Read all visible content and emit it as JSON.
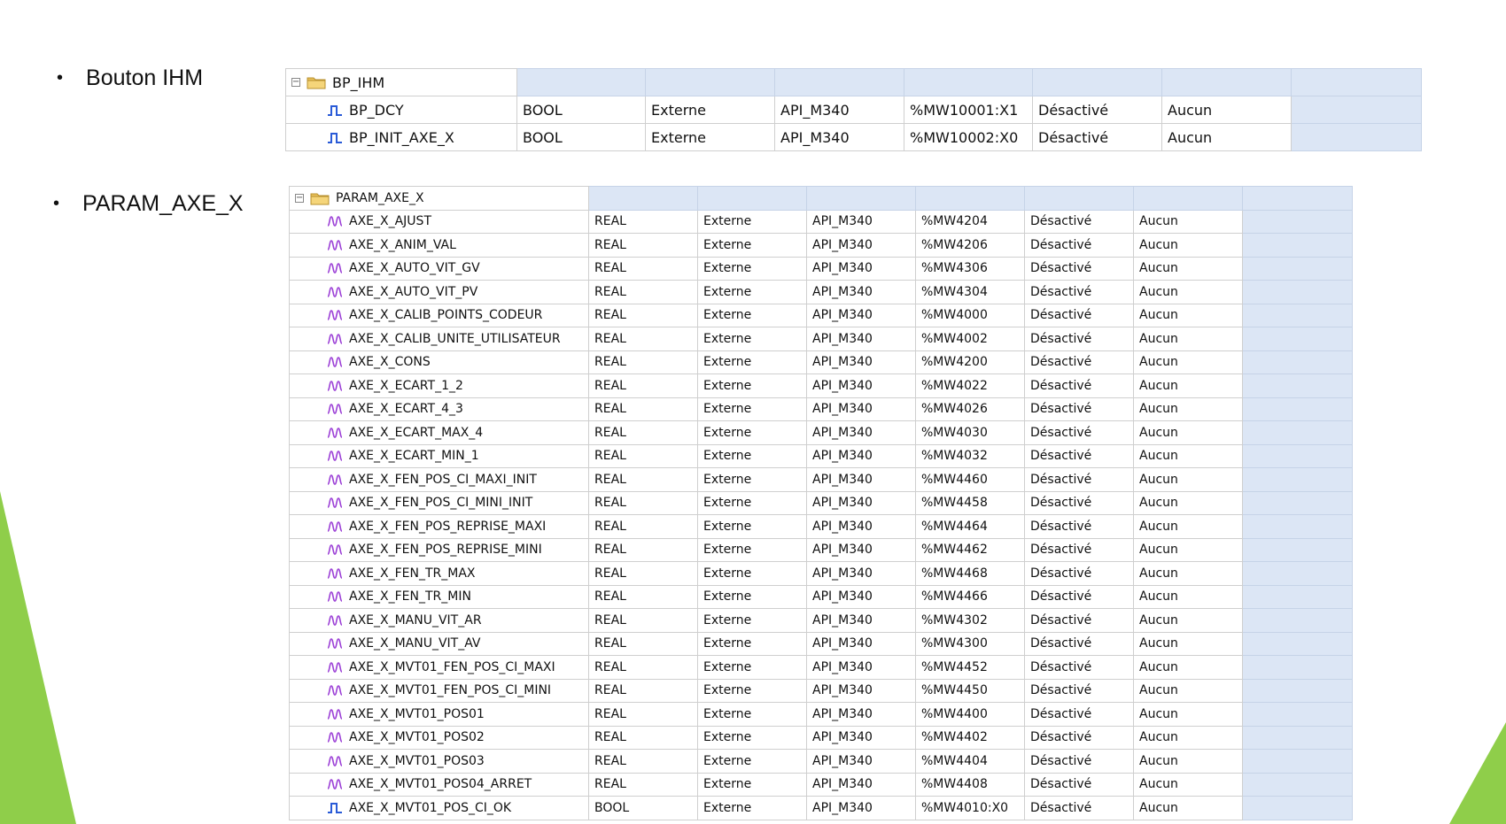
{
  "colors": {
    "accent_green": "#8fce4a",
    "header_fill": "#dce6f5",
    "bool_icon": "#2a5bd7",
    "real_icon": "#9b3fd6"
  },
  "bullets": [
    {
      "label": "Bouton IHM"
    },
    {
      "label": "PARAM_AXE_X"
    }
  ],
  "bp_ihm": {
    "group_name": "BP_IHM",
    "rows": [
      {
        "icon": "bool-icon",
        "name": "BP_DCY",
        "type": "BOOL",
        "scope": "Externe",
        "device": "API_M340",
        "address": "%MW10001:X1",
        "status": "Désactivé",
        "action": "Aucun"
      },
      {
        "icon": "bool-icon",
        "name": "BP_INIT_AXE_X",
        "type": "BOOL",
        "scope": "Externe",
        "device": "API_M340",
        "address": "%MW10002:X0",
        "status": "Désactivé",
        "action": "Aucun"
      }
    ]
  },
  "param_axe_x": {
    "group_name": "PARAM_AXE_X",
    "rows": [
      {
        "icon": "real-icon",
        "name": "AXE_X_AJUST",
        "type": "REAL",
        "scope": "Externe",
        "device": "API_M340",
        "address": "%MW4204",
        "status": "Désactivé",
        "action": "Aucun"
      },
      {
        "icon": "real-icon",
        "name": "AXE_X_ANIM_VAL",
        "type": "REAL",
        "scope": "Externe",
        "device": "API_M340",
        "address": "%MW4206",
        "status": "Désactivé",
        "action": "Aucun"
      },
      {
        "icon": "real-icon",
        "name": "AXE_X_AUTO_VIT_GV",
        "type": "REAL",
        "scope": "Externe",
        "device": "API_M340",
        "address": "%MW4306",
        "status": "Désactivé",
        "action": "Aucun"
      },
      {
        "icon": "real-icon",
        "name": "AXE_X_AUTO_VIT_PV",
        "type": "REAL",
        "scope": "Externe",
        "device": "API_M340",
        "address": "%MW4304",
        "status": "Désactivé",
        "action": "Aucun"
      },
      {
        "icon": "real-icon",
        "name": "AXE_X_CALIB_POINTS_CODEUR",
        "type": "REAL",
        "scope": "Externe",
        "device": "API_M340",
        "address": "%MW4000",
        "status": "Désactivé",
        "action": "Aucun"
      },
      {
        "icon": "real-icon",
        "name": "AXE_X_CALIB_UNITE_UTILISATEUR",
        "type": "REAL",
        "scope": "Externe",
        "device": "API_M340",
        "address": "%MW4002",
        "status": "Désactivé",
        "action": "Aucun"
      },
      {
        "icon": "real-icon",
        "name": "AXE_X_CONS",
        "type": "REAL",
        "scope": "Externe",
        "device": "API_M340",
        "address": "%MW4200",
        "status": "Désactivé",
        "action": "Aucun"
      },
      {
        "icon": "real-icon",
        "name": "AXE_X_ECART_1_2",
        "type": "REAL",
        "scope": "Externe",
        "device": "API_M340",
        "address": "%MW4022",
        "status": "Désactivé",
        "action": "Aucun"
      },
      {
        "icon": "real-icon",
        "name": "AXE_X_ECART_4_3",
        "type": "REAL",
        "scope": "Externe",
        "device": "API_M340",
        "address": "%MW4026",
        "status": "Désactivé",
        "action": "Aucun"
      },
      {
        "icon": "real-icon",
        "name": "AXE_X_ECART_MAX_4",
        "type": "REAL",
        "scope": "Externe",
        "device": "API_M340",
        "address": "%MW4030",
        "status": "Désactivé",
        "action": "Aucun"
      },
      {
        "icon": "real-icon",
        "name": "AXE_X_ECART_MIN_1",
        "type": "REAL",
        "scope": "Externe",
        "device": "API_M340",
        "address": "%MW4032",
        "status": "Désactivé",
        "action": "Aucun"
      },
      {
        "icon": "real-icon",
        "name": "AXE_X_FEN_POS_CI_MAXI_INIT",
        "type": "REAL",
        "scope": "Externe",
        "device": "API_M340",
        "address": "%MW4460",
        "status": "Désactivé",
        "action": "Aucun"
      },
      {
        "icon": "real-icon",
        "name": "AXE_X_FEN_POS_CI_MINI_INIT",
        "type": "REAL",
        "scope": "Externe",
        "device": "API_M340",
        "address": "%MW4458",
        "status": "Désactivé",
        "action": "Aucun"
      },
      {
        "icon": "real-icon",
        "name": "AXE_X_FEN_POS_REPRISE_MAXI",
        "type": "REAL",
        "scope": "Externe",
        "device": "API_M340",
        "address": "%MW4464",
        "status": "Désactivé",
        "action": "Aucun"
      },
      {
        "icon": "real-icon",
        "name": "AXE_X_FEN_POS_REPRISE_MINI",
        "type": "REAL",
        "scope": "Externe",
        "device": "API_M340",
        "address": "%MW4462",
        "status": "Désactivé",
        "action": "Aucun"
      },
      {
        "icon": "real-icon",
        "name": "AXE_X_FEN_TR_MAX",
        "type": "REAL",
        "scope": "Externe",
        "device": "API_M340",
        "address": "%MW4468",
        "status": "Désactivé",
        "action": "Aucun"
      },
      {
        "icon": "real-icon",
        "name": "AXE_X_FEN_TR_MIN",
        "type": "REAL",
        "scope": "Externe",
        "device": "API_M340",
        "address": "%MW4466",
        "status": "Désactivé",
        "action": "Aucun"
      },
      {
        "icon": "real-icon",
        "name": "AXE_X_MANU_VIT_AR",
        "type": "REAL",
        "scope": "Externe",
        "device": "API_M340",
        "address": "%MW4302",
        "status": "Désactivé",
        "action": "Aucun"
      },
      {
        "icon": "real-icon",
        "name": "AXE_X_MANU_VIT_AV",
        "type": "REAL",
        "scope": "Externe",
        "device": "API_M340",
        "address": "%MW4300",
        "status": "Désactivé",
        "action": "Aucun"
      },
      {
        "icon": "real-icon",
        "name": "AXE_X_MVT01_FEN_POS_CI_MAXI",
        "type": "REAL",
        "scope": "Externe",
        "device": "API_M340",
        "address": "%MW4452",
        "status": "Désactivé",
        "action": "Aucun"
      },
      {
        "icon": "real-icon",
        "name": "AXE_X_MVT01_FEN_POS_CI_MINI",
        "type": "REAL",
        "scope": "Externe",
        "device": "API_M340",
        "address": "%MW4450",
        "status": "Désactivé",
        "action": "Aucun"
      },
      {
        "icon": "real-icon",
        "name": "AXE_X_MVT01_POS01",
        "type": "REAL",
        "scope": "Externe",
        "device": "API_M340",
        "address": "%MW4400",
        "status": "Désactivé",
        "action": "Aucun"
      },
      {
        "icon": "real-icon",
        "name": "AXE_X_MVT01_POS02",
        "type": "REAL",
        "scope": "Externe",
        "device": "API_M340",
        "address": "%MW4402",
        "status": "Désactivé",
        "action": "Aucun"
      },
      {
        "icon": "real-icon",
        "name": "AXE_X_MVT01_POS03",
        "type": "REAL",
        "scope": "Externe",
        "device": "API_M340",
        "address": "%MW4404",
        "status": "Désactivé",
        "action": "Aucun"
      },
      {
        "icon": "real-icon",
        "name": "AXE_X_MVT01_POS04_ARRET",
        "type": "REAL",
        "scope": "Externe",
        "device": "API_M340",
        "address": "%MW4408",
        "status": "Désactivé",
        "action": "Aucun"
      },
      {
        "icon": "bool-icon",
        "name": "AXE_X_MVT01_POS_CI_OK",
        "type": "BOOL",
        "scope": "Externe",
        "device": "API_M340",
        "address": "%MW4010:X0",
        "status": "Désactivé",
        "action": "Aucun"
      }
    ]
  }
}
